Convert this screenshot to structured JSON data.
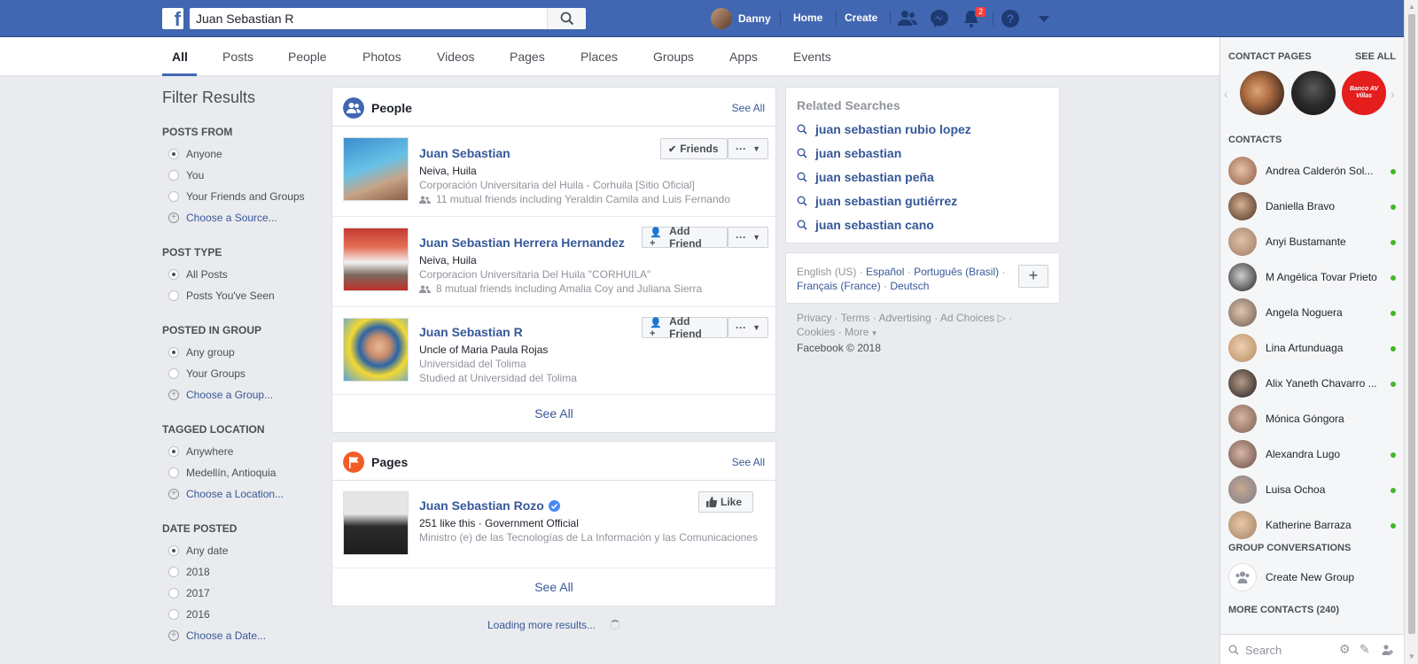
{
  "topbar": {
    "search_value": "Juan Sebastian R",
    "profile_name": "Danny",
    "home_label": "Home",
    "create_label": "Create",
    "notifications_count": "2"
  },
  "tabs": [
    "All",
    "Posts",
    "People",
    "Photos",
    "Videos",
    "Pages",
    "Places",
    "Groups",
    "Apps",
    "Events"
  ],
  "filters": {
    "title": "Filter Results",
    "posts_from": {
      "heading": "POSTS FROM",
      "options": [
        "Anyone",
        "You",
        "Your Friends and Groups"
      ],
      "link": "Choose a Source..."
    },
    "post_type": {
      "heading": "POST TYPE",
      "options": [
        "All Posts",
        "Posts You've Seen"
      ]
    },
    "posted_in_group": {
      "heading": "POSTED IN GROUP",
      "options": [
        "Any group",
        "Your Groups"
      ],
      "link": "Choose a Group..."
    },
    "tagged_location": {
      "heading": "TAGGED LOCATION",
      "options": [
        "Anywhere",
        "Medellín, Antioquia"
      ],
      "link": "Choose a Location..."
    },
    "date_posted": {
      "heading": "DATE POSTED",
      "options": [
        "Any date",
        "2018",
        "2017",
        "2016"
      ],
      "link": "Choose a Date..."
    }
  },
  "people": {
    "title": "People",
    "see_all": "See All",
    "footer": "See All",
    "results": [
      {
        "name": "Juan Sebastian",
        "line1": "Neiva, Huila",
        "line2": "Corporación Universitaria del Huila - Corhuila [Sitio Oficial]",
        "line3": "11 mutual friends including Yeraldin Camila and Luis Fernando",
        "button": "Friends"
      },
      {
        "name": "Juan Sebastian Herrera Hernandez",
        "line1": "Neiva, Huila",
        "line2": "Corporacion Universitaria Del Huila \"CORHUILA\"",
        "line3": "8 mutual friends including Amalia Coy and Juliana Sierra",
        "button": "Add Friend"
      },
      {
        "name": "Juan Sebastian R",
        "line1": "Uncle of Maria Paula Rojas",
        "line2": "Universidad del Tolima",
        "line3": "Studied at Universidad del Tolima",
        "button": "Add Friend"
      }
    ]
  },
  "pages": {
    "title": "Pages",
    "see_all": "See All",
    "footer": "See All",
    "result": {
      "name": "Juan Sebastian Rozo",
      "line1": "251 like this · Government Official",
      "line2": "Ministro (e) de las Tecnologías de La Información y las Comunicaciones",
      "button": "Like"
    }
  },
  "loading_text": "Loading more results...",
  "related": {
    "title": "Related Searches",
    "items": [
      "juan sebastian rubio lopez",
      "juan sebastian",
      "juan sebastian peña",
      "juan sebastian gutiérrez",
      "juan sebastian cano"
    ]
  },
  "languages": {
    "current": "English (US)",
    "others": [
      "Español",
      "Português (Brasil)",
      "Français (France)",
      "Deutsch"
    ]
  },
  "footer": {
    "links": [
      "Privacy",
      "Terms",
      "Advertising",
      "Ad Choices",
      "Cookies",
      "More"
    ],
    "copyright": "Facebook © 2018"
  },
  "chat": {
    "contact_pages": "CONTACT PAGES",
    "see_all": "SEE ALL",
    "contacts_heading": "CONTACTS",
    "contacts": [
      "Andrea Calderón Sol...",
      "Daniella Bravo",
      "Anyi Bustamante",
      "M Angélica Tovar Prieto",
      "Angela Noguera",
      "Lina Artunduaga",
      "Alix Yaneth Chavarro ...",
      "Mónica Góngora",
      "Alexandra Lugo",
      "Luisa Ochoa",
      "Katherine Barraza"
    ],
    "group_heading": "GROUP CONVERSATIONS",
    "create_group": "Create New Group",
    "more_contacts": "MORE CONTACTS (240)",
    "search_placeholder": "Search",
    "page_badge": "Banco AV Villas"
  },
  "colors": {
    "brand": "#4267b2",
    "link": "#385898",
    "online": "#42b72a",
    "badge": "#fa3e3e"
  }
}
